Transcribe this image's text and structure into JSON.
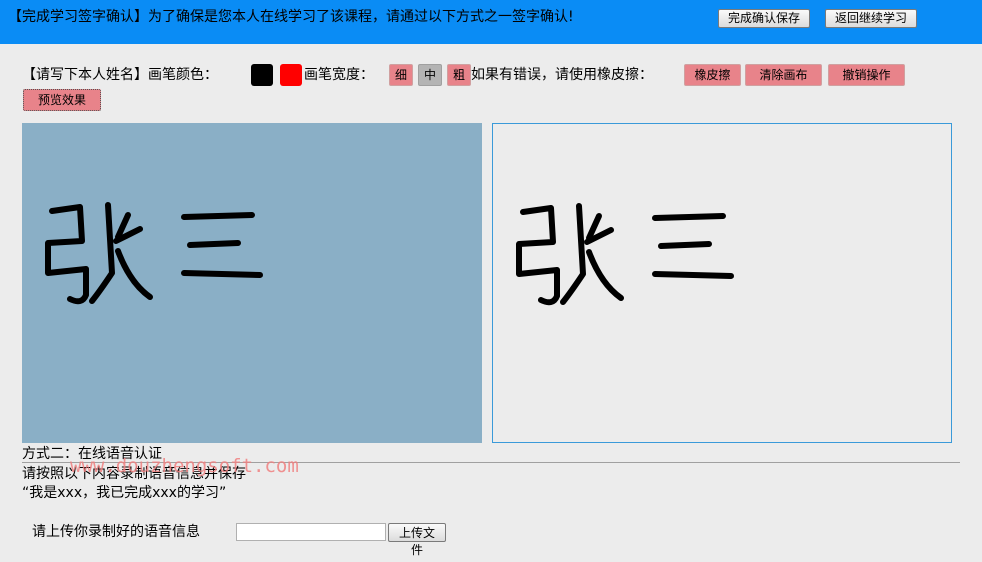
{
  "header": {
    "message": "【完成学习签字确认】为了确保是您本人在线学习了该课程，请通过以下方式之一签字确认!",
    "confirm_save": "完成确认保存",
    "back_continue": "返回继续学习"
  },
  "toolbar": {
    "name_prompt": "【请写下本人姓名】画笔颜色：",
    "colors": [
      "#000000",
      "#ff0000"
    ],
    "width_label": "画笔宽度：",
    "width_thin": "细",
    "width_medium": "中",
    "width_thick": "粗",
    "eraser_hint": "如果有错误，请使用橡皮擦：",
    "eraser": "橡皮擦",
    "clear_canvas": "清除画布",
    "undo": "撤销操作",
    "preview": "预览效果"
  },
  "voice": {
    "method_title": "方式二：在线语音认证",
    "instruction": "请按照以下内容录制语音信息并保存",
    "script": "“我是xxx，我已完成xxx的学习”",
    "upload_label": "请上传你录制好的语音信息",
    "upload_button": "上传文件"
  },
  "watermark": "www.douzhengsoft.com"
}
